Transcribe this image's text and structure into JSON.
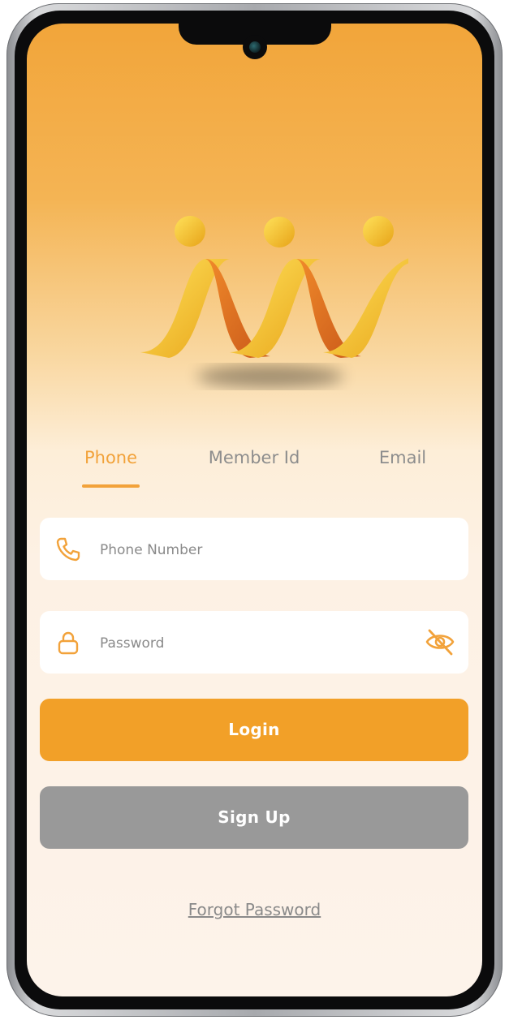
{
  "tabs": [
    {
      "label": "Phone",
      "active": true
    },
    {
      "label": "Member Id",
      "active": false
    },
    {
      "label": "Email",
      "active": false
    }
  ],
  "phone_field": {
    "placeholder": "Phone Number",
    "value": "",
    "icon": "phone-icon"
  },
  "password_field": {
    "placeholder": "Password",
    "value": "",
    "icon": "lock-icon",
    "toggle_icon": "eye-off-icon"
  },
  "buttons": {
    "login": "Login",
    "signup": "Sign Up"
  },
  "links": {
    "forgot": "Forgot Password"
  },
  "colors": {
    "accent": "#f2a028",
    "secondary_button": "#999999",
    "tab_inactive": "#8d8d8d"
  }
}
